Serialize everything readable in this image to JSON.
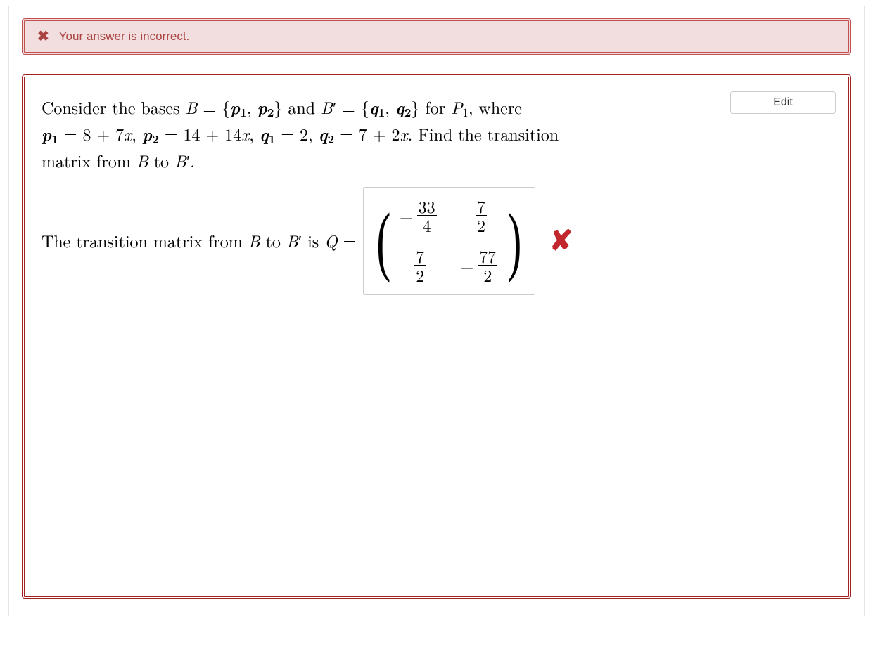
{
  "alert": {
    "icon_name": "x-icon",
    "glyph": "✖",
    "message": "Your answer is incorrect."
  },
  "buttons": {
    "edit": "Edit"
  },
  "question": {
    "line1": {
      "pre": "Consider the bases ",
      "B": "B",
      "eq1": " = {",
      "p1": "p",
      "p1sub": "1",
      "comma1": ", ",
      "p2": "p",
      "p2sub": "2",
      "end1": "} and ",
      "Bp": "B",
      "prime": "′",
      "eq2": " = {",
      "q1": "q",
      "q1sub": "1",
      "comma2": ", ",
      "q2": "q",
      "q2sub": "2",
      "for": "} for ",
      "P1": "P",
      "P1sub": "1",
      "where": ", where"
    },
    "line2": "p₁ = 8 + 7x,  p₂ = 14 + 14x,  q₁ = 2,  q₂ = 7 + 2x.  Find the transition",
    "line2_parts": {
      "p1": "p",
      "p1s": "1",
      "e1": " = 8 + 7",
      "x1": "x",
      "c1": ", ",
      "p2": "p",
      "p2s": "2",
      "e2": " = 14 + 14",
      "x2": "x",
      "c2": ", ",
      "q1": "q",
      "q1s": "1",
      "e3": " = 2, ",
      "q2": "q",
      "q2s": "2",
      "e4": " = 7 + 2",
      "x3": "x",
      "tail": ". Find the transition"
    },
    "line3": {
      "pre": "matrix from ",
      "B": "B",
      "to": " to ",
      "Bp": "B",
      "prime": "′",
      "end": "."
    },
    "answer_label": {
      "pre": "The transition matrix from ",
      "B": "B",
      "to": " to ",
      "Bp": "B",
      "prime": "′",
      "is": " is ",
      "Q": "Q",
      "eq": " ="
    },
    "grading": {
      "wrong_glyph": "✘"
    }
  },
  "matrix": {
    "cells": [
      {
        "neg": "−",
        "num": "33",
        "den": "4"
      },
      {
        "neg": "",
        "num": "7",
        "den": "2"
      },
      {
        "neg": "",
        "num": "7",
        "den": "2"
      },
      {
        "neg": "−",
        "num": "77",
        "den": "2"
      }
    ]
  }
}
